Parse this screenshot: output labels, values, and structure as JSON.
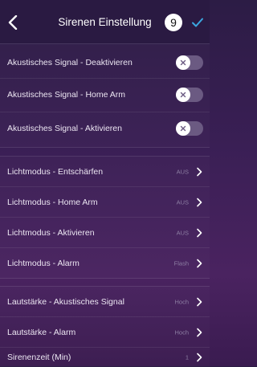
{
  "header": {
    "title": "Sirenen Einstellung",
    "step": "9"
  },
  "colors": {
    "accent": "#3ba7e0",
    "header_bg": "#2a1a42",
    "toggle_track": "#6b5a82"
  },
  "sections": {
    "signals": [
      {
        "label": "Akustisches Signal - Deaktivieren",
        "state": "off"
      },
      {
        "label": "Akustisches Signal - Home Arm",
        "state": "off"
      },
      {
        "label": "Akustisches Signal - Aktivieren",
        "state": "off"
      }
    ],
    "light_modes": [
      {
        "label": "Lichtmodus - Entschärfen",
        "value": "AUS"
      },
      {
        "label": "Lichtmodus - Home Arm",
        "value": "AUS"
      },
      {
        "label": "Lichtmodus - Aktivieren",
        "value": "AUS"
      },
      {
        "label": "Lichtmodus - Alarm",
        "value": "Flash"
      }
    ],
    "volume": [
      {
        "label": "Lautstärke - Akustisches Signal",
        "value": "Hoch"
      },
      {
        "label": "Lautstärke - Alarm",
        "value": "Hoch"
      },
      {
        "label": "Sirenenzeit (Min)",
        "value": "1"
      }
    ]
  }
}
